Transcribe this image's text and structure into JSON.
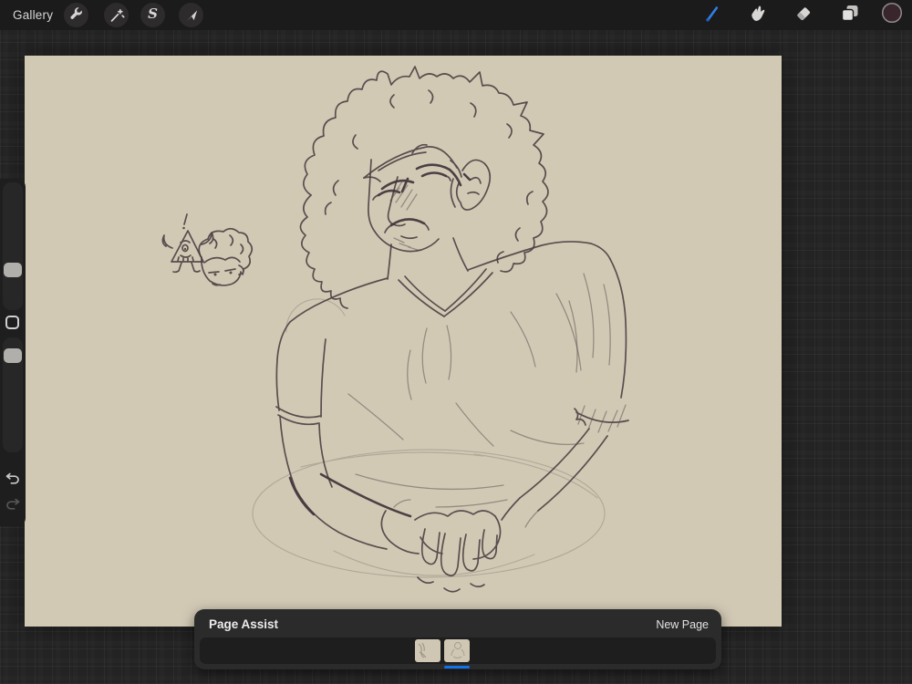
{
  "topbar": {
    "gallery_label": "Gallery",
    "left_tools": [
      {
        "id": "actions",
        "icon": "wrench-icon"
      },
      {
        "id": "adjustments",
        "icon": "magic-wand-icon"
      },
      {
        "id": "selection",
        "icon": "selection-s-icon",
        "glyph": "S"
      },
      {
        "id": "transform",
        "icon": "transform-arrow-icon"
      }
    ],
    "right_tools": [
      {
        "id": "paint",
        "icon": "brush-icon",
        "selected": true
      },
      {
        "id": "smudge",
        "icon": "smudge-finger-icon",
        "selected": false
      },
      {
        "id": "erase",
        "icon": "eraser-icon",
        "selected": false
      },
      {
        "id": "layers",
        "icon": "layers-icon",
        "selected": false
      },
      {
        "id": "color",
        "icon": "color-swatch-circle",
        "swatch_color": "#39262c"
      }
    ]
  },
  "sidebar": {
    "sliders": [
      {
        "id": "brush-size"
      },
      {
        "id": "brush-opacity"
      }
    ],
    "modify_button": {
      "id": "modify"
    },
    "undo": {
      "icon": "undo-arrow-icon",
      "enabled": true
    },
    "redo": {
      "icon": "redo-arrow-icon",
      "enabled": false
    }
  },
  "canvas": {
    "background_color": "#d2c9b5",
    "artwork_description": "Pencil sketch: curly-haired person frowning with closed eyes, v-neck t-shirt, arms crossed with clasped hands over an oval lap guide; small doodle of a triangle character with exclamation mark and an unamused chibi head at upper left"
  },
  "page_assist": {
    "title": "Page Assist",
    "new_page_label": "New Page",
    "pages": [
      {
        "index": 1,
        "selected": false
      },
      {
        "index": 2,
        "selected": true
      }
    ],
    "selection_color": "#1273e8"
  },
  "colors": {
    "topbar_bg": "#1b1b1b",
    "workspace_bg": "#232323",
    "panel_bg": "#2b2b2b",
    "canvas_bg": "#d2c9b5",
    "accent_blue": "#2f7fe6"
  }
}
